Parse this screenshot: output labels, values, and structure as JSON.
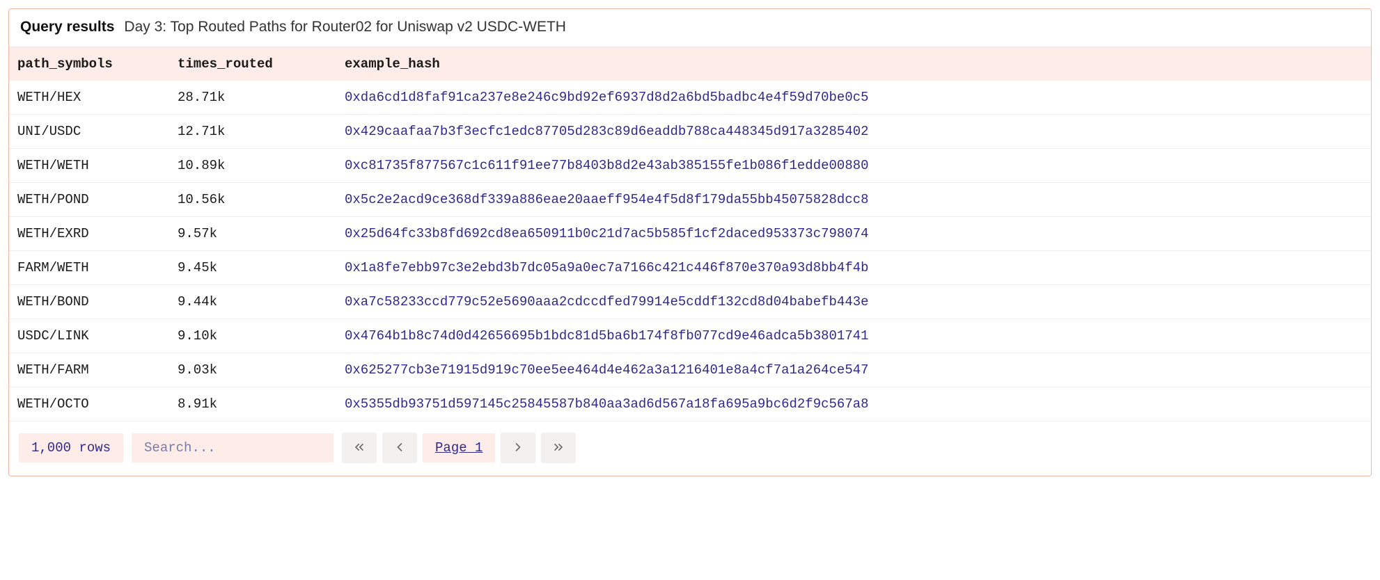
{
  "header": {
    "title": "Query results",
    "subtitle": "Day 3: Top Routed Paths for Router02 for Uniswap v2 USDC-WETH"
  },
  "columns": {
    "path_symbols": "path_symbols",
    "times_routed": "times_routed",
    "example_hash": "example_hash"
  },
  "rows": [
    {
      "path_symbols": "WETH/HEX",
      "times_routed": "28.71k",
      "example_hash": "0xda6cd1d8faf91ca237e8e246c9bd92ef6937d8d2a6bd5badbc4e4f59d70be0c5"
    },
    {
      "path_symbols": "UNI/USDC",
      "times_routed": "12.71k",
      "example_hash": "0x429caafaa7b3f3ecfc1edc87705d283c89d6eaddb788ca448345d917a3285402"
    },
    {
      "path_symbols": "WETH/WETH",
      "times_routed": "10.89k",
      "example_hash": "0xc81735f877567c1c611f91ee77b8403b8d2e43ab385155fe1b086f1edde00880"
    },
    {
      "path_symbols": "WETH/POND",
      "times_routed": "10.56k",
      "example_hash": "0x5c2e2acd9ce368df339a886eae20aaeff954e4f5d8f179da55bb45075828dcc8"
    },
    {
      "path_symbols": "WETH/EXRD",
      "times_routed": "9.57k",
      "example_hash": "0x25d64fc33b8fd692cd8ea650911b0c21d7ac5b585f1cf2daced953373c798074"
    },
    {
      "path_symbols": "FARM/WETH",
      "times_routed": "9.45k",
      "example_hash": "0x1a8fe7ebb97c3e2ebd3b7dc05a9a0ec7a7166c421c446f870e370a93d8bb4f4b"
    },
    {
      "path_symbols": "WETH/BOND",
      "times_routed": "9.44k",
      "example_hash": "0xa7c58233ccd779c52e5690aaa2cdccdfed79914e5cddf132cd8d04babefb443e"
    },
    {
      "path_symbols": "USDC/LINK",
      "times_routed": "9.10k",
      "example_hash": "0x4764b1b8c74d0d42656695b1bdc81d5ba6b174f8fb077cd9e46adca5b3801741"
    },
    {
      "path_symbols": "WETH/FARM",
      "times_routed": "9.03k",
      "example_hash": "0x625277cb3e71915d919c70ee5ee464d4e462a3a1216401e8a4cf7a1a264ce547"
    },
    {
      "path_symbols": "WETH/OCTO",
      "times_routed": "8.91k",
      "example_hash": "0x5355db93751d597145c25845587b840aa3ad6d567a18fa695a9bc6d2f9c567a8"
    }
  ],
  "footer": {
    "row_count": "1,000 rows",
    "search_placeholder": "Search...",
    "page_label": "Page 1"
  }
}
